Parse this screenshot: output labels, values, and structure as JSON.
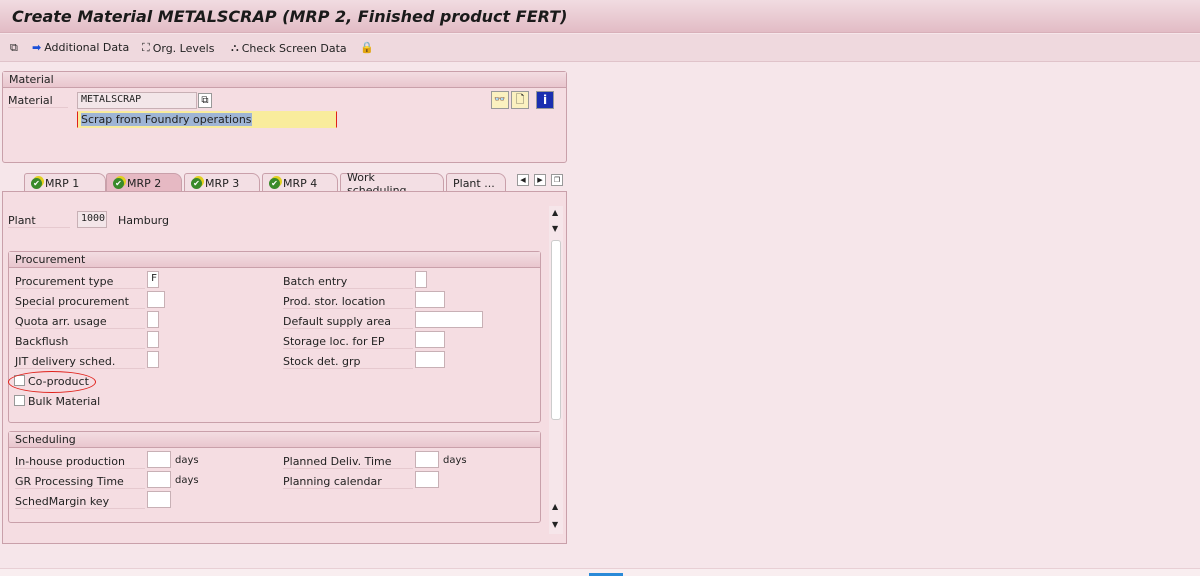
{
  "title": "Create Material METALSCRAP (MRP 2, Finished product FERT)",
  "toolbar": {
    "additional_data": "Additional Data",
    "org_levels": "Org. Levels",
    "check_screen": "Check Screen Data"
  },
  "material": {
    "header": "Material",
    "label": "Material",
    "value": "METALSCRAP",
    "description": "Scrap from Foundry operations"
  },
  "tabs": [
    {
      "label": "MRP 1"
    },
    {
      "label": "MRP 2"
    },
    {
      "label": "MRP 3"
    },
    {
      "label": "MRP 4"
    },
    {
      "label": "Work scheduling"
    },
    {
      "label": "Plant ..."
    }
  ],
  "active_tab": "MRP 2",
  "plant": {
    "label": "Plant",
    "value": "1000",
    "name": "Hamburg"
  },
  "procurement": {
    "header": "Procurement",
    "left": [
      {
        "label": "Procurement type",
        "value": "F"
      },
      {
        "label": "Special procurement",
        "value": ""
      },
      {
        "label": "Quota arr. usage",
        "value": ""
      },
      {
        "label": "Backflush",
        "value": ""
      },
      {
        "label": "JIT delivery sched.",
        "value": ""
      }
    ],
    "right": [
      {
        "label": "Batch entry",
        "value": ""
      },
      {
        "label": "Prod. stor. location",
        "value": ""
      },
      {
        "label": "Default supply area",
        "value": ""
      },
      {
        "label": "Storage loc. for EP",
        "value": ""
      },
      {
        "label": "Stock det. grp",
        "value": ""
      }
    ],
    "co_product": "Co-product",
    "bulk_material": "Bulk Material"
  },
  "scheduling": {
    "header": "Scheduling",
    "inhouse": "In-house production",
    "gr_time": "GR Processing Time",
    "sched_margin": "SchedMargin key",
    "planned_deliv": "Planned Deliv. Time",
    "planning_cal": "Planning calendar",
    "days": "days"
  },
  "colors": {
    "highlight": "#f9ec9c",
    "annotation": "#e0201a"
  }
}
